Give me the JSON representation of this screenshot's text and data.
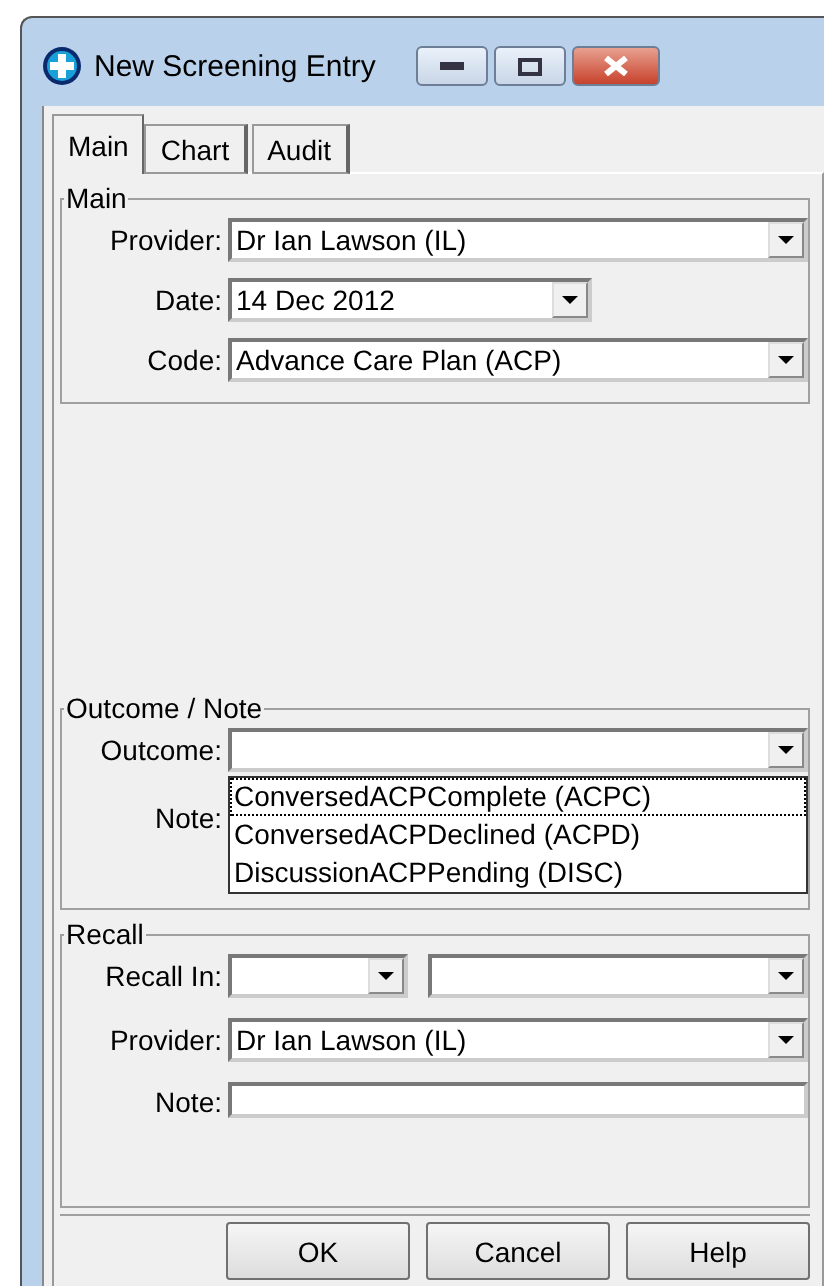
{
  "window": {
    "title": "New Screening Entry"
  },
  "tabs": [
    {
      "label": "Main",
      "selected": true
    },
    {
      "label": "Chart",
      "selected": false
    },
    {
      "label": "Audit",
      "selected": false
    }
  ],
  "main_group": {
    "title": "Main",
    "provider": {
      "label": "Provider:",
      "value": "Dr Ian Lawson (IL)"
    },
    "date": {
      "label": "Date:",
      "value": "14 Dec 2012"
    },
    "code": {
      "label": "Code:",
      "value": "Advance Care Plan (ACP)"
    }
  },
  "outcome_group": {
    "title": "Outcome / Note",
    "outcome": {
      "label": "Outcome:",
      "options": [
        {
          "label": "ConversedACPComplete (ACPC)",
          "selected": true
        },
        {
          "label": "ConversedACPDeclined (ACPD)",
          "selected": false
        },
        {
          "label": "DiscussionACPPending (DISC)",
          "selected": false
        }
      ]
    },
    "note": {
      "label": "Note:"
    }
  },
  "recall_group": {
    "title": "Recall",
    "recall_in": {
      "label": "Recall In:"
    },
    "provider": {
      "label": "Provider:",
      "value": "Dr Ian Lawson (IL)"
    },
    "note": {
      "label": "Note:"
    }
  },
  "buttons": [
    "OK",
    "Cancel",
    "Help"
  ]
}
